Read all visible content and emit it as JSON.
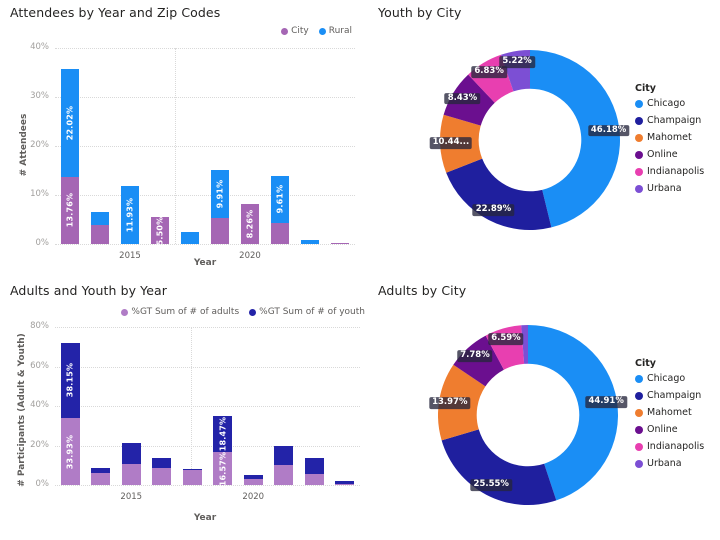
{
  "panels": {
    "attendees": {
      "title": "Attendees by Year and Zip Codes",
      "legend": [
        {
          "label": "City",
          "color": "#a566b4"
        },
        {
          "label": "Rural",
          "color": "#1a8ef5"
        }
      ],
      "ylabel": "# Attendees",
      "xlabel": "Year"
    },
    "youth_city": {
      "title": "Youth by City",
      "legend_title": "City"
    },
    "adults_youth": {
      "title": "Adults and Youth by Year",
      "legend": [
        {
          "label": "%GT Sum of # of adults",
          "color": "#b07cc6"
        },
        {
          "label": "%GT Sum of # of youth",
          "color": "#2323a8"
        }
      ],
      "ylabel": "# Participants (Adult & Youth)",
      "xlabel": "Year"
    },
    "adults_city": {
      "title": "Adults by City",
      "legend_title": "City"
    }
  },
  "chart_data": [
    {
      "id": "attendees",
      "type": "bar",
      "title": "Attendees by Year and Zip Codes",
      "xlabel": "Year",
      "ylabel": "# Attendees",
      "ylim": [
        0,
        40
      ],
      "yticks": [
        "0%",
        "10%",
        "20%",
        "30%",
        "40%"
      ],
      "ytick_values": [
        0,
        10,
        20,
        30,
        40
      ],
      "xticks": [
        "2015",
        "2020"
      ],
      "grid": true,
      "stacked": true,
      "series": [
        {
          "name": "City",
          "color": "#a566b4",
          "values": [
            13.76,
            3.95,
            0.0,
            5.5,
            0.0,
            5.22,
            8.26,
            4.32,
            0.0,
            0.18
          ]
        },
        {
          "name": "Rural",
          "color": "#1a8ef5",
          "values": [
            22.02,
            2.66,
            11.93,
            0.0,
            2.52,
            9.91,
            0.0,
            9.61,
            0.72,
            0.0
          ]
        }
      ],
      "bar_labels": [
        {
          "bar": 0,
          "series": "Rural",
          "text": "22.02%"
        },
        {
          "bar": 0,
          "series": "City",
          "text": "13.76%"
        },
        {
          "bar": 2,
          "series": "Rural",
          "text": "11.93%"
        },
        {
          "bar": 3,
          "series": "City",
          "text": "5.50%"
        },
        {
          "bar": 5,
          "series": "Rural",
          "text": "9.91%"
        },
        {
          "bar": 6,
          "series": "City",
          "text": "8.26%"
        },
        {
          "bar": 7,
          "series": "Rural",
          "text": "9.61%"
        }
      ]
    },
    {
      "id": "youth_by_city",
      "type": "pie",
      "title": "Youth by City",
      "legend_title": "City",
      "legend_position": "right",
      "labels": [
        "Chicago",
        "Champaign",
        "Mahomet",
        "Online",
        "Indianapolis",
        "Urbana"
      ],
      "values": [
        46.18,
        22.89,
        10.44,
        8.43,
        6.83,
        5.22
      ],
      "display_labels": [
        "46.18%",
        "22.89%",
        "10.44...",
        "8.43%",
        "6.83%",
        "5.22%"
      ],
      "colors": [
        "#1a8ef5",
        "#1f1f9e",
        "#ef7d2f",
        "#6b0f8f",
        "#e83fb0",
        "#7c4fd4"
      ]
    },
    {
      "id": "adults_youth",
      "type": "bar",
      "title": "Adults and Youth by Year",
      "xlabel": "Year",
      "ylabel": "# Participants (Adult & Youth)",
      "ylim": [
        0,
        80
      ],
      "yticks": [
        "0%",
        "20%",
        "40%",
        "60%",
        "80%"
      ],
      "ytick_values": [
        0,
        20,
        40,
        60,
        80
      ],
      "xticks": [
        "2015",
        "2020"
      ],
      "grid": true,
      "stacked": true,
      "series": [
        {
          "name": "%GT Sum of # of adults",
          "color": "#b07cc6",
          "values": [
            33.93,
            5.84,
            10.5,
            8.5,
            7.6,
            16.57,
            3.1,
            10.2,
            5.4,
            0.3
          ]
        },
        {
          "name": "%GT Sum of # of youth",
          "color": "#2323a8",
          "values": [
            38.15,
            3.0,
            10.8,
            5.4,
            0.6,
            18.47,
            2.2,
            9.4,
            8.3,
            1.8
          ]
        }
      ],
      "bar_labels": [
        {
          "bar": 0,
          "series": "%GT Sum of # of youth",
          "text": "38.15%"
        },
        {
          "bar": 0,
          "series": "%GT Sum of # of adults",
          "text": "33.93%"
        },
        {
          "bar": 5,
          "series": "%GT Sum of # of youth",
          "text": "18.47%"
        },
        {
          "bar": 5,
          "series": "%GT Sum of # of adults",
          "text": "16.57%"
        }
      ]
    },
    {
      "id": "adults_by_city",
      "type": "pie",
      "title": "Adults by City",
      "legend_title": "City",
      "legend_position": "right",
      "labels": [
        "Chicago",
        "Champaign",
        "Mahomet",
        "Online",
        "Indianapolis",
        "Urbana"
      ],
      "values": [
        44.91,
        25.55,
        13.97,
        7.78,
        6.59,
        1.2
      ],
      "display_labels": [
        "44.91%",
        "25.55%",
        "13.97%",
        "7.78%",
        "6.59%",
        ""
      ],
      "colors": [
        "#1a8ef5",
        "#1f1f9e",
        "#ef7d2f",
        "#6b0f8f",
        "#e83fb0",
        "#7c4fd4"
      ]
    }
  ]
}
